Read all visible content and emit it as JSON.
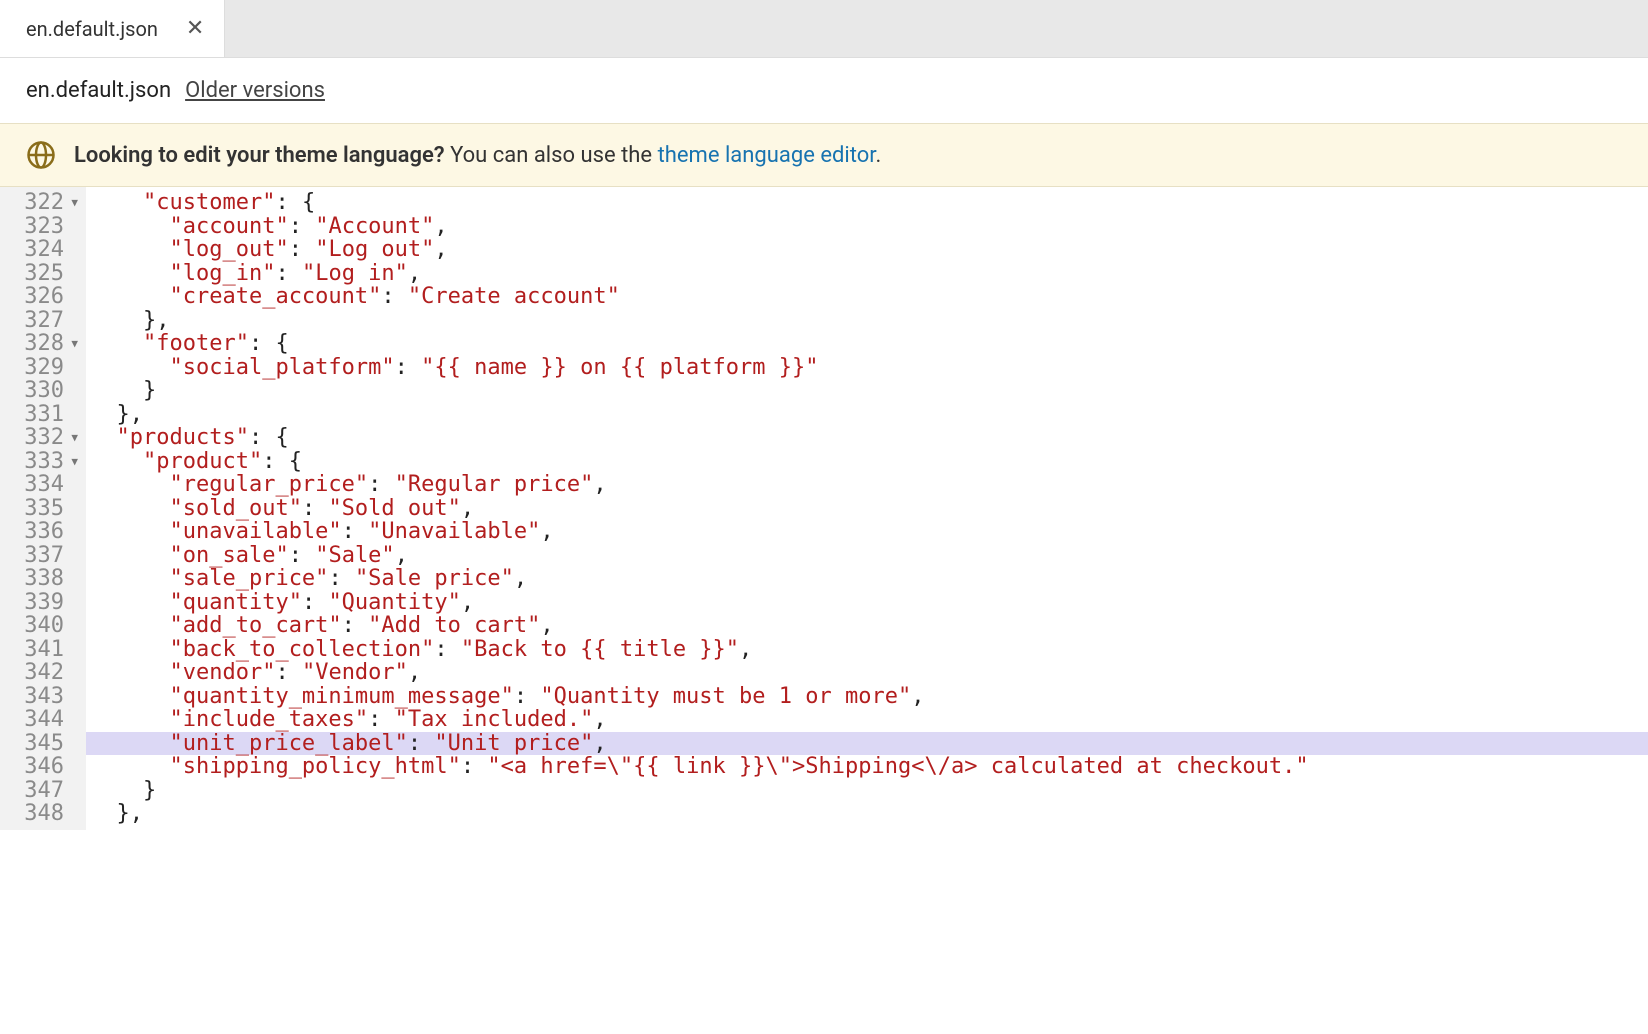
{
  "tab": {
    "filename": "en.default.json"
  },
  "subheader": {
    "filename": "en.default.json",
    "older": "Older versions"
  },
  "banner": {
    "bold": "Looking to edit your theme language?",
    "text": " You can also use the ",
    "link": "theme language editor",
    "tail": "."
  },
  "gutter": [
    {
      "n": "322",
      "f": true
    },
    {
      "n": "323"
    },
    {
      "n": "324"
    },
    {
      "n": "325"
    },
    {
      "n": "326"
    },
    {
      "n": "327"
    },
    {
      "n": "328",
      "f": true
    },
    {
      "n": "329"
    },
    {
      "n": "330"
    },
    {
      "n": "331"
    },
    {
      "n": "332",
      "f": true
    },
    {
      "n": "333",
      "f": true
    },
    {
      "n": "334"
    },
    {
      "n": "335"
    },
    {
      "n": "336"
    },
    {
      "n": "337"
    },
    {
      "n": "338"
    },
    {
      "n": "339"
    },
    {
      "n": "340"
    },
    {
      "n": "341"
    },
    {
      "n": "342"
    },
    {
      "n": "343"
    },
    {
      "n": "344"
    },
    {
      "n": "345"
    },
    {
      "n": "346"
    },
    {
      "n": "347"
    },
    {
      "n": "348"
    }
  ],
  "code": {
    "c322": "    \"customer\": {",
    "c323": "      \"account\": \"Account\",",
    "c324": "      \"log_out\": \"Log out\",",
    "c325": "      \"log_in\": \"Log in\",",
    "c326": "      \"create_account\": \"Create account\"",
    "c327": "    },",
    "c328": "    \"footer\": {",
    "c329": "      \"social_platform\": \"{{ name }} on {{ platform }}\"",
    "c330": "    }",
    "c331": "  },",
    "c332": "  \"products\": {",
    "c333": "    \"product\": {",
    "c334": "      \"regular_price\": \"Regular price\",",
    "c335": "      \"sold_out\": \"Sold out\",",
    "c336": "      \"unavailable\": \"Unavailable\",",
    "c337": "      \"on_sale\": \"Sale\",",
    "c338": "      \"sale_price\": \"Sale price\",",
    "c339": "      \"quantity\": \"Quantity\",",
    "c340": "      \"add_to_cart\": \"Add to cart\",",
    "c341": "      \"back_to_collection\": \"Back to {{ title }}\",",
    "c342": "      \"vendor\": \"Vendor\",",
    "c343": "      \"quantity_minimum_message\": \"Quantity must be 1 or more\",",
    "c344": "      \"include_taxes\": \"Tax included.\",",
    "c345": "      \"unit_price_label\": \"Unit price\",",
    "c346": "      \"shipping_policy_html\": \"<a href=\\\"{{ link }}\\\">Shipping<\\/a> calculated at checkout.\"",
    "c347": "    }",
    "c348": "  },"
  },
  "highlight_line": 345
}
